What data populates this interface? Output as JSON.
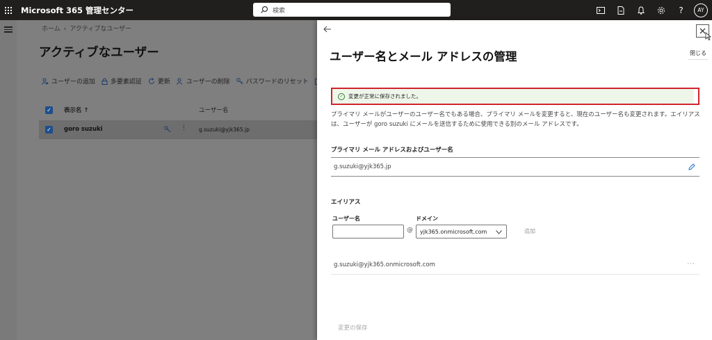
{
  "topbar": {
    "app_title": "Microsoft 365 管理センター",
    "search_placeholder": "検索",
    "avatar_initials": "AY",
    "help_label": "?"
  },
  "background": {
    "breadcrumb": [
      "ホーム",
      "アクティブなユーザー"
    ],
    "breadcrumb_sep": "›",
    "page_title": "アクティブなユーザー",
    "commands": [
      {
        "icon": "person-icon",
        "label": "ユーザーの追加"
      },
      {
        "icon": "lock-icon",
        "label": "多要素認証"
      },
      {
        "icon": "refresh-icon",
        "label": "更新"
      },
      {
        "icon": "person-icon",
        "label": "ユーザーの削除"
      },
      {
        "icon": "key-icon",
        "label": "パスワードのリセット"
      }
    ],
    "columns": {
      "display_name": "表示名 ↑",
      "username": "ユーザー名"
    },
    "row": {
      "display_name": "goro suzuki",
      "username": "g.suzuki@yjk365.jp",
      "more": "⋮"
    }
  },
  "panel": {
    "title": "ユーザー名とメール アドレスの管理",
    "close_label": "閉じる",
    "success_message": "変更が正常に保存されました。",
    "description": "プライマリ メールがユーザーのユーザー名でもある場合、プライマリ メールを変更すると、現在のユーザー名も変更されます。エイリアスは、ユーザーが goro suzuki にメールを送信するために使用できる別のメール アドレスです。",
    "primary_section_label": "プライマリ メール アドレスおよびユーザー名",
    "primary_email": "g.suzuki@yjk365.jp",
    "alias_section_label": "エイリアス",
    "alias_username_label": "ユーザー名",
    "alias_username_value": "",
    "domain_label": "ドメイン",
    "at_sign": "@",
    "domain_value": "yjk365.onmicrosoft.com",
    "add_label": "追加",
    "alias_list": [
      "g.suzuki@yjk365.onmicrosoft.com"
    ],
    "more_label": "···",
    "save_label": "変更の保存"
  },
  "colors": {
    "topbar": "#201f1e",
    "success_border": "#d0232b",
    "success_icon": "#2f7d32",
    "accent": "#1f6fc5"
  }
}
